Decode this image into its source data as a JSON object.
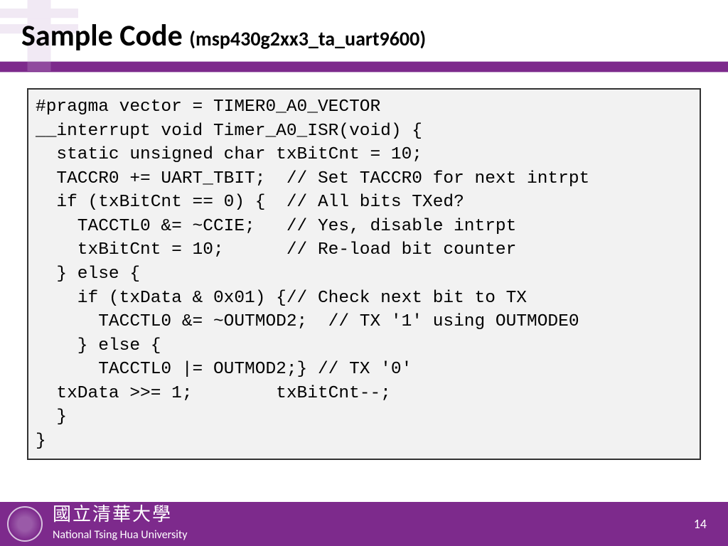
{
  "title": {
    "main": "Sample Code ",
    "sub": "(msp430g2xx3_ta_uart9600)"
  },
  "code": "#pragma vector = TIMER0_A0_VECTOR\n__interrupt void Timer_A0_ISR(void) {\n  static unsigned char txBitCnt = 10;\n  TACCR0 += UART_TBIT;  // Set TACCR0 for next intrpt\n  if (txBitCnt == 0) {  // All bits TXed?\n    TACCTL0 &= ~CCIE;   // Yes, disable intrpt\n    txBitCnt = 10;      // Re-load bit counter\n  } else {\n    if (txData & 0x01) {// Check next bit to TX\n      TACCTL0 &= ~OUTMOD2;  // TX '1' using OUTMODE0\n    } else {\n      TACCTL0 |= OUTMOD2;} // TX '0'\n  txData >>= 1;        txBitCnt--;\n  }\n}",
  "footer": {
    "cn": "國立清華大學",
    "en": "National Tsing Hua University",
    "page": "14"
  }
}
